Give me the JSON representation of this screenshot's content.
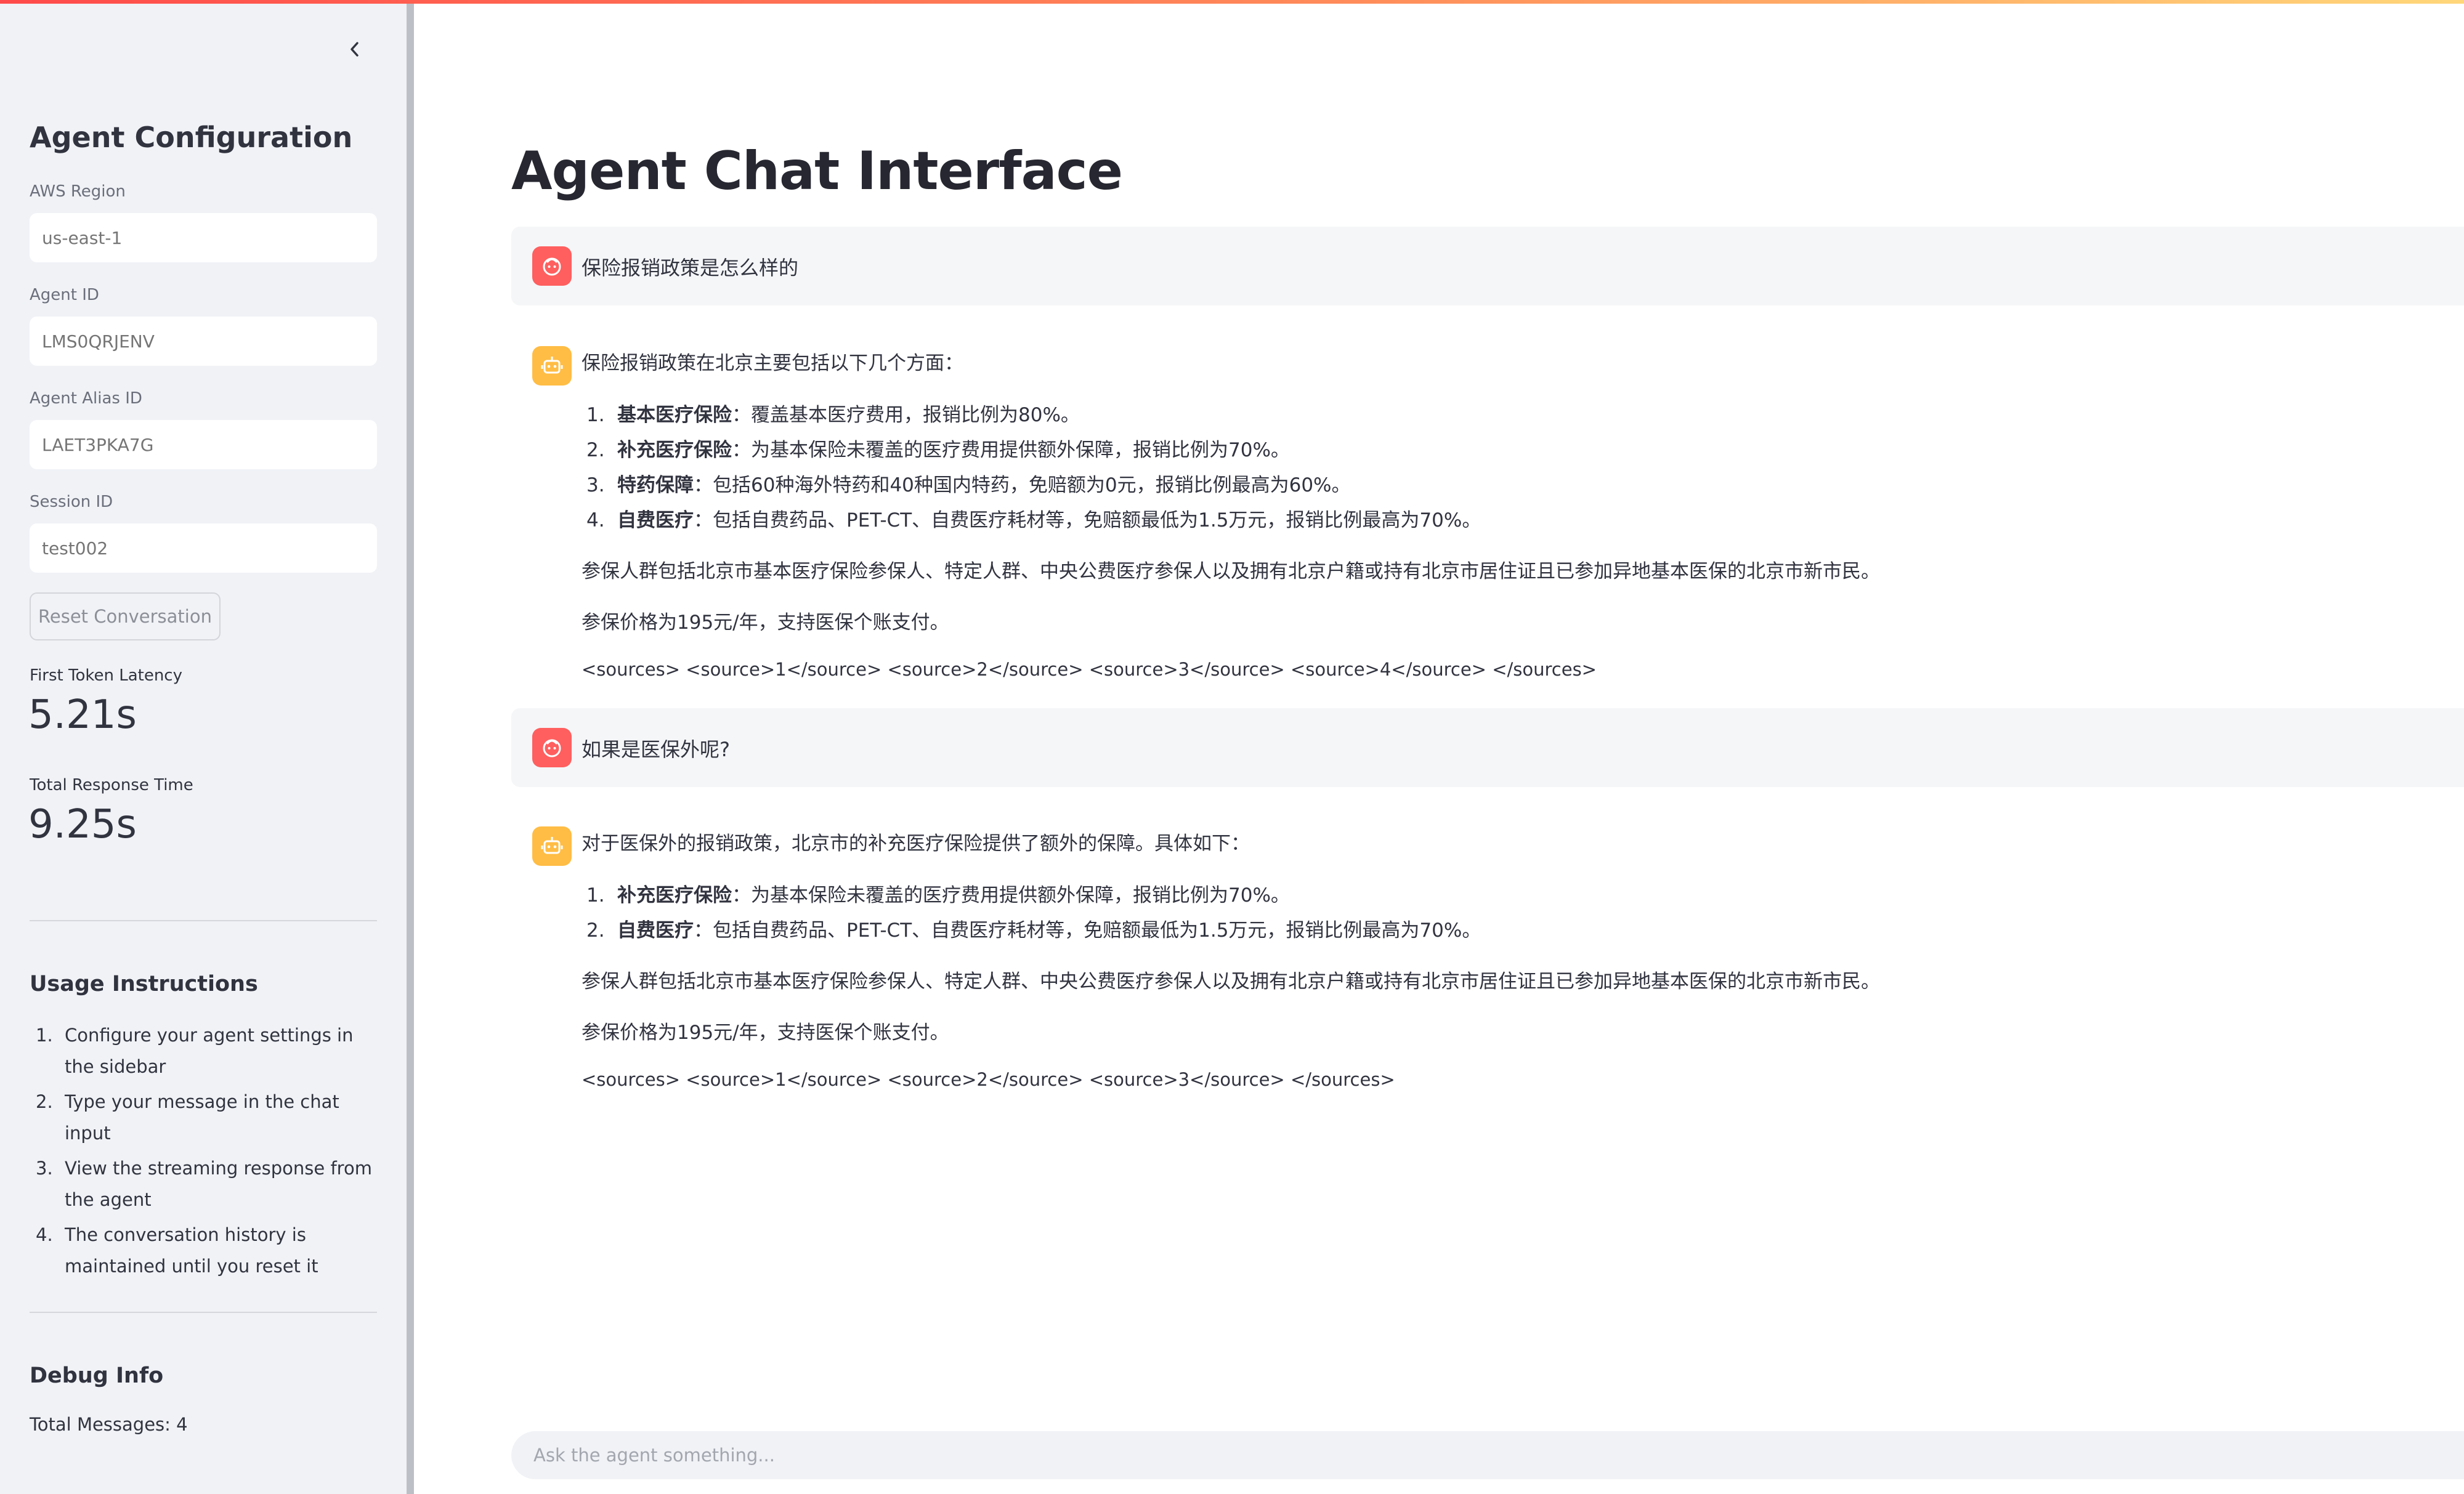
{
  "colors": {
    "accent": "#ff4b4b",
    "user_avatar": "#ff5f5f",
    "assistant_avatar": "#ffbd45",
    "sidebar_bg": "#f0f2f6"
  },
  "sidebar": {
    "collapse_icon": "chevron-left-icon",
    "title": "Agent Configuration",
    "fields": [
      {
        "label": "AWS Region",
        "placeholder": "us-east-1"
      },
      {
        "label": "Agent ID",
        "placeholder": "LMS0QRJENV"
      },
      {
        "label": "Agent Alias ID",
        "placeholder": "LAET3PKA7G"
      },
      {
        "label": "Session ID",
        "placeholder": "test002"
      }
    ],
    "reset_label": "Reset Conversation",
    "metrics": [
      {
        "label": "First Token Latency",
        "value": "5.21s"
      },
      {
        "label": "Total Response Time",
        "value": "9.25s"
      }
    ],
    "usage": {
      "title": "Usage Instructions",
      "items": [
        {
          "num": "1.",
          "text": "Configure your agent settings in the sidebar"
        },
        {
          "num": "2.",
          "text": "Type your message in the chat input"
        },
        {
          "num": "3.",
          "text": "View the streaming response from the agent"
        },
        {
          "num": "4.",
          "text": "The conversation history is maintained until you reset it"
        }
      ]
    },
    "debug": {
      "title": "Debug Info",
      "text": "Total Messages: 4"
    }
  },
  "main": {
    "title": "Agent Chat Interface",
    "messages": [
      {
        "role": "user",
        "avatar_icon": "user-face-icon",
        "text": "保险报销政策是怎么样的"
      },
      {
        "role": "assistant",
        "avatar_icon": "robot-icon",
        "intro": "保险报销政策在北京主要包括以下几个方面：",
        "items": [
          {
            "num": "1.",
            "bold": "基本医疗保险",
            "text": "：覆盖基本医疗费用，报销比例为80%。"
          },
          {
            "num": "2.",
            "bold": "补充医疗保险",
            "text": "：为基本保险未覆盖的医疗费用提供额外保障，报销比例为70%。"
          },
          {
            "num": "3.",
            "bold": "特药保障",
            "text": "：包括60种海外特药和40种国内特药，免赔额为0元，报销比例最高为60%。"
          },
          {
            "num": "4.",
            "bold": "自费医疗",
            "text": "：包括自费药品、PET-CT、自费医疗耗材等，免赔额最低为1.5万元，报销比例最高为70%。"
          }
        ],
        "para1": "参保人群包括北京市基本医疗保险参保人、特定人群、中央公费医疗参保人以及拥有北京户籍或持有北京市居住证且已参加异地基本医保的北京市新市民。",
        "para2": "参保价格为195元/年，支持医保个账支付。",
        "sources": "<sources> <source>1</source> <source>2</source> <source>3</source> <source>4</source> </sources>"
      },
      {
        "role": "user",
        "avatar_icon": "user-face-icon",
        "text": "如果是医保外呢?"
      },
      {
        "role": "assistant",
        "avatar_icon": "robot-icon",
        "intro": "对于医保外的报销政策，北京市的补充医疗保险提供了额外的保障。具体如下：",
        "items": [
          {
            "num": "1.",
            "bold": "补充医疗保险",
            "text": "：为基本保险未覆盖的医疗费用提供额外保障，报销比例为70%。"
          },
          {
            "num": "2.",
            "bold": "自费医疗",
            "text": "：包括自费药品、PET-CT、自费医疗耗材等，免赔额最低为1.5万元，报销比例最高为70%。"
          }
        ],
        "para1": "参保人群包括北京市基本医疗保险参保人、特定人群、中央公费医疗参保人以及拥有北京户籍或持有北京市居住证且已参加异地基本医保的北京市新市民。",
        "para2": "参保价格为195元/年，支持医保个账支付。",
        "sources": "<sources> <source>1</source> <source>2</source> <source>3</source> </sources>"
      }
    ],
    "chat_input": {
      "placeholder": "Ask the agent something..."
    }
  }
}
